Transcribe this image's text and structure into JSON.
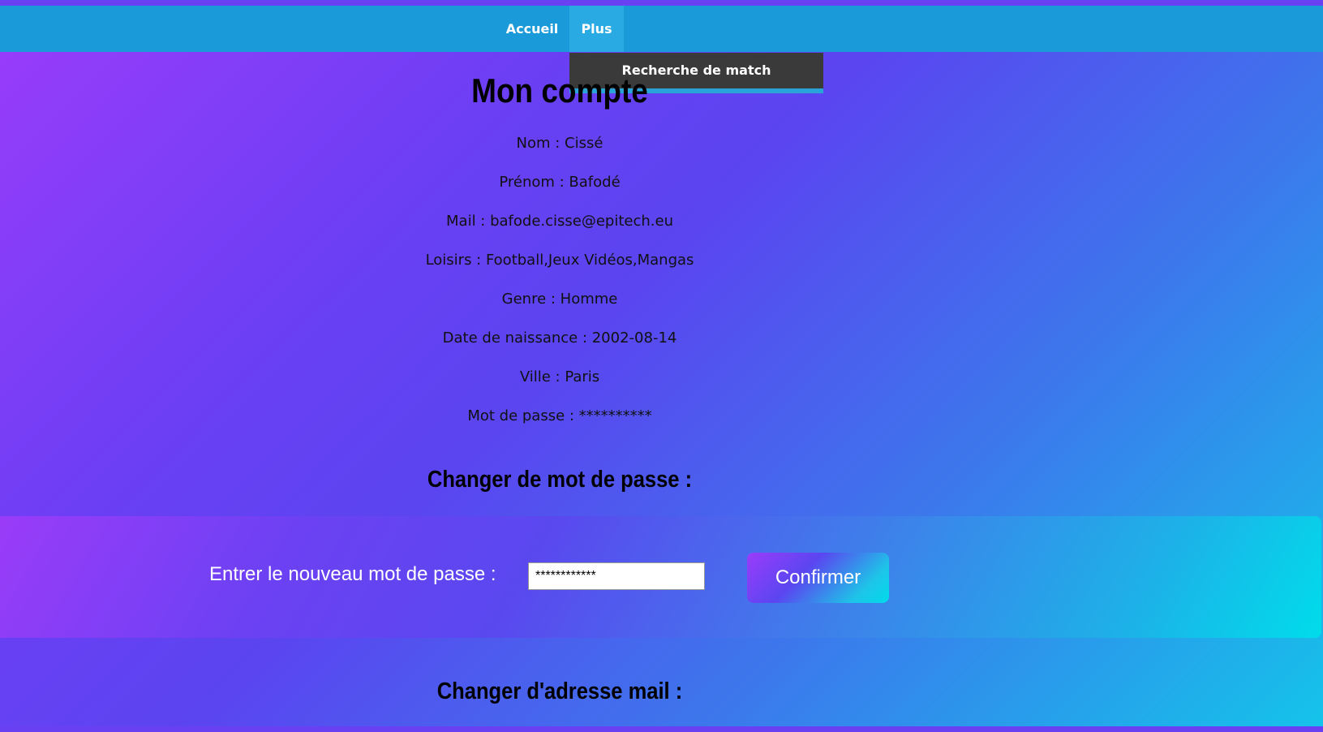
{
  "nav": {
    "items": [
      {
        "label": "Accueil"
      },
      {
        "label": "Plus"
      }
    ],
    "dropdown": {
      "items": [
        {
          "label": "Recherche de match"
        }
      ]
    }
  },
  "page": {
    "title": "Mon compte"
  },
  "account": {
    "nom": "Nom : Cissé",
    "prenom": "Prénom : Bafodé",
    "mail": "Mail : bafode.cisse@epitech.eu",
    "loisirs": "Loisirs : Football,Jeux Vidéos,Mangas",
    "genre": "Genre : Homme",
    "naissance": "Date de naissance : 2002-08-14",
    "ville": "Ville : Paris",
    "motdepasse": "Mot de passe : **********"
  },
  "password_section": {
    "heading": "Changer de mot de passe :",
    "label": "Entrer le nouveau mot de passe :",
    "input_value": "************",
    "confirm_label": "Confirmer"
  },
  "email_section": {
    "heading": "Changer d'adresse mail :"
  }
}
